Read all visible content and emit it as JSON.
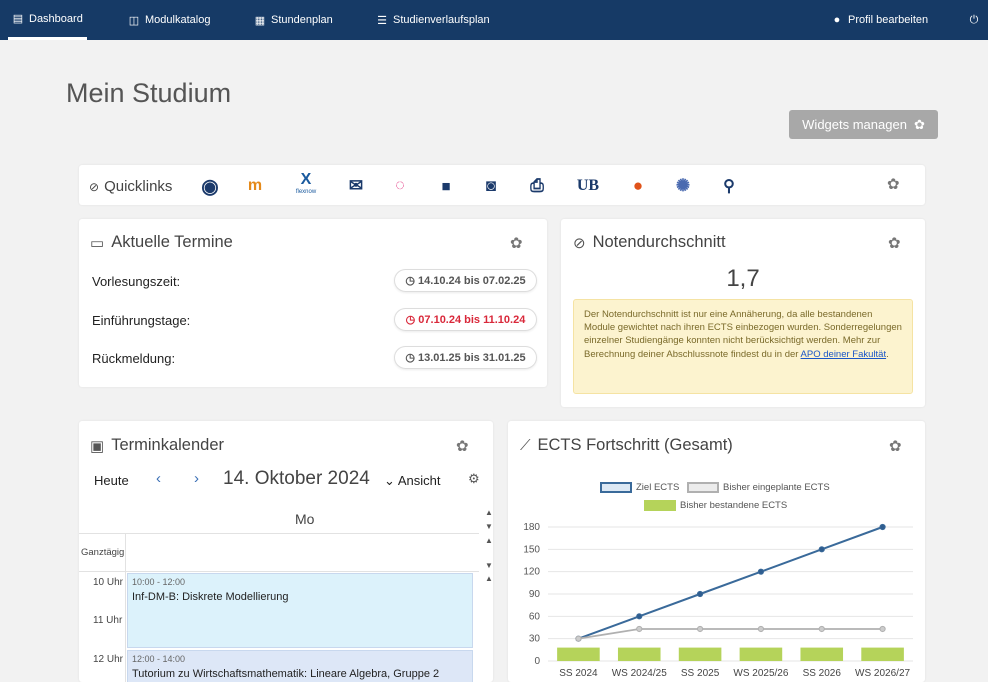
{
  "nav": {
    "items": [
      {
        "label": "Dashboard",
        "icon": "dashboard-icon"
      },
      {
        "label": "Modulkatalog",
        "icon": "book-icon"
      },
      {
        "label": "Stundenplan",
        "icon": "calendar-icon"
      },
      {
        "label": "Studienverlaufsplan",
        "icon": "list-icon"
      }
    ],
    "profile": "Profil bearbeiten"
  },
  "page": {
    "title": "Mein Studium",
    "widgets_button": "Widgets managen"
  },
  "quicklinks": {
    "title": "Quicklinks",
    "icons": [
      "eduroam-icon",
      "moodle-icon",
      "flexnow-icon",
      "mail-icon",
      "chat-icon",
      "teams-icon",
      "contact-card-icon",
      "printer-icon",
      "ub-library-icon",
      "firefox-icon",
      "cluster-icon",
      "podcast-icon"
    ],
    "ub_label": "UB",
    "flexnow_label": "flexnow"
  },
  "termine": {
    "title": "Aktuelle Termine",
    "rows": [
      {
        "label": "Vorlesungszeit:",
        "range": "14.10.24 bis 07.02.25",
        "highlight": false
      },
      {
        "label": "Einführungstage:",
        "range": "07.10.24 bis 11.10.24",
        "highlight": true
      },
      {
        "label": "Rückmeldung:",
        "range": "13.01.25 bis 31.01.25",
        "highlight": false
      }
    ]
  },
  "noten": {
    "title": "Notendurchschnitt",
    "value": "1,7",
    "note_text": "Der Notendurchschnitt ist nur eine Annäherung, da alle bestandenen Module gewichtet nach ihren ECTS einbezogen wurden. Sonderregelungen einzelner Studiengänge konnten nicht berücksichtigt werden. Mehr zur Berechnung deiner Abschlussnote findest du in der ",
    "note_link": "APO deiner Fakultät",
    "note_end": "."
  },
  "kalender": {
    "title": "Terminkalender",
    "heute": "Heute",
    "prev": "‹",
    "next": "›",
    "date": "14. Oktober 2024",
    "ansicht": "Ansicht",
    "day": "Mo",
    "ganztaegig": "Ganztägig",
    "hours": [
      "10 Uhr",
      "11 Uhr",
      "12 Uhr"
    ],
    "events": [
      {
        "time": "10:00 - 12:00",
        "title": "Inf-DM-B: Diskrete Modellierung"
      },
      {
        "time": "12:00 - 14:00",
        "title": "Tutorium zu Wirtschaftsmathematik: Lineare Algebra, Gruppe 2"
      }
    ]
  },
  "ects": {
    "title": "ECTS Fortschritt (Gesamt)"
  },
  "colors": {
    "nav": "#163a66",
    "ziel": "#3a6a9a",
    "geplant": "#b0b0b0",
    "bestanden": "#b5d35a",
    "warn_bg": "#fcf3cf",
    "red": "#d9283a"
  },
  "chart_data": {
    "type": "line",
    "categories": [
      "SS 2024",
      "WS 2024/25",
      "SS 2025",
      "WS 2025/26",
      "SS 2026",
      "WS 2026/27"
    ],
    "series": [
      {
        "name": "Ziel ECTS",
        "type": "line",
        "values": [
          30,
          60,
          90,
          120,
          150,
          180
        ]
      },
      {
        "name": "Bisher eingeplante ECTS",
        "type": "line",
        "values": [
          30,
          43,
          43,
          43,
          43,
          43
        ]
      },
      {
        "name": "Bisher bestandene ECTS",
        "type": "bar",
        "values": [
          18,
          18,
          18,
          18,
          18,
          18
        ]
      }
    ],
    "yticks": [
      0,
      30,
      60,
      90,
      120,
      150,
      180
    ],
    "ylim": [
      0,
      180
    ],
    "legend_position": "top",
    "grid": true
  }
}
